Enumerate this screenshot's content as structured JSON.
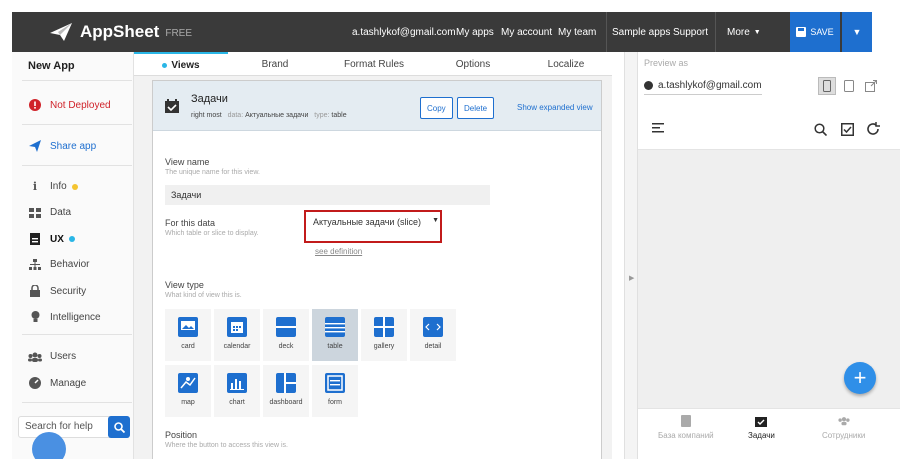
{
  "header": {
    "brand": "AppSheet",
    "tier": "FREE",
    "email": "a.tashlykof@gmail.com",
    "nav": [
      "My apps",
      "My account",
      "My team",
      "Sample apps",
      "Support"
    ],
    "more": "More",
    "save": "SAVE"
  },
  "sidebar": {
    "app_name": "New App",
    "status": "Not Deployed",
    "share": "Share app",
    "items": [
      "Info",
      "Data",
      "UX",
      "Behavior",
      "Security",
      "Intelligence",
      "Users",
      "Manage"
    ],
    "search_placeholder": "Search for help"
  },
  "tabs": [
    "Views",
    "Brand",
    "Format Rules",
    "Options",
    "Localize"
  ],
  "view": {
    "title": "Задачи",
    "position_value": "right most",
    "data_label": "data",
    "data_value": "Актуальные задачи",
    "type_label": "type",
    "type_value": "table",
    "copy": "Copy",
    "delete": "Delete",
    "expand": "Show expanded view",
    "name_label": "View name",
    "name_hint": "The unique name for this view.",
    "name_value": "Задачи",
    "data_field_label": "For this data",
    "data_field_hint": "Which table or slice to display.",
    "data_select": "Актуальные задачи (slice)",
    "see_definition": "see definition",
    "type_field_label": "View type",
    "type_field_hint": "What kind of view this is.",
    "types": [
      "card",
      "calendar",
      "deck",
      "table",
      "gallery",
      "detail",
      "map",
      "chart",
      "dashboard",
      "form"
    ],
    "selected_type": "table",
    "position_label": "Position",
    "position_hint": "Where the button to access this view is."
  },
  "preview": {
    "label": "Preview as",
    "user": "a.tashlykof@gmail.com",
    "bottom_nav": [
      "База компаний",
      "Задачи",
      "Сотрудники"
    ]
  },
  "colors": {
    "accent": "#1e6fcf",
    "tab_indicator": "#29b6e6",
    "status_red": "#d0232a",
    "info_dot": "#f4c430",
    "ux_dot": "#29b6e6",
    "highlight": "#c21b1b"
  }
}
